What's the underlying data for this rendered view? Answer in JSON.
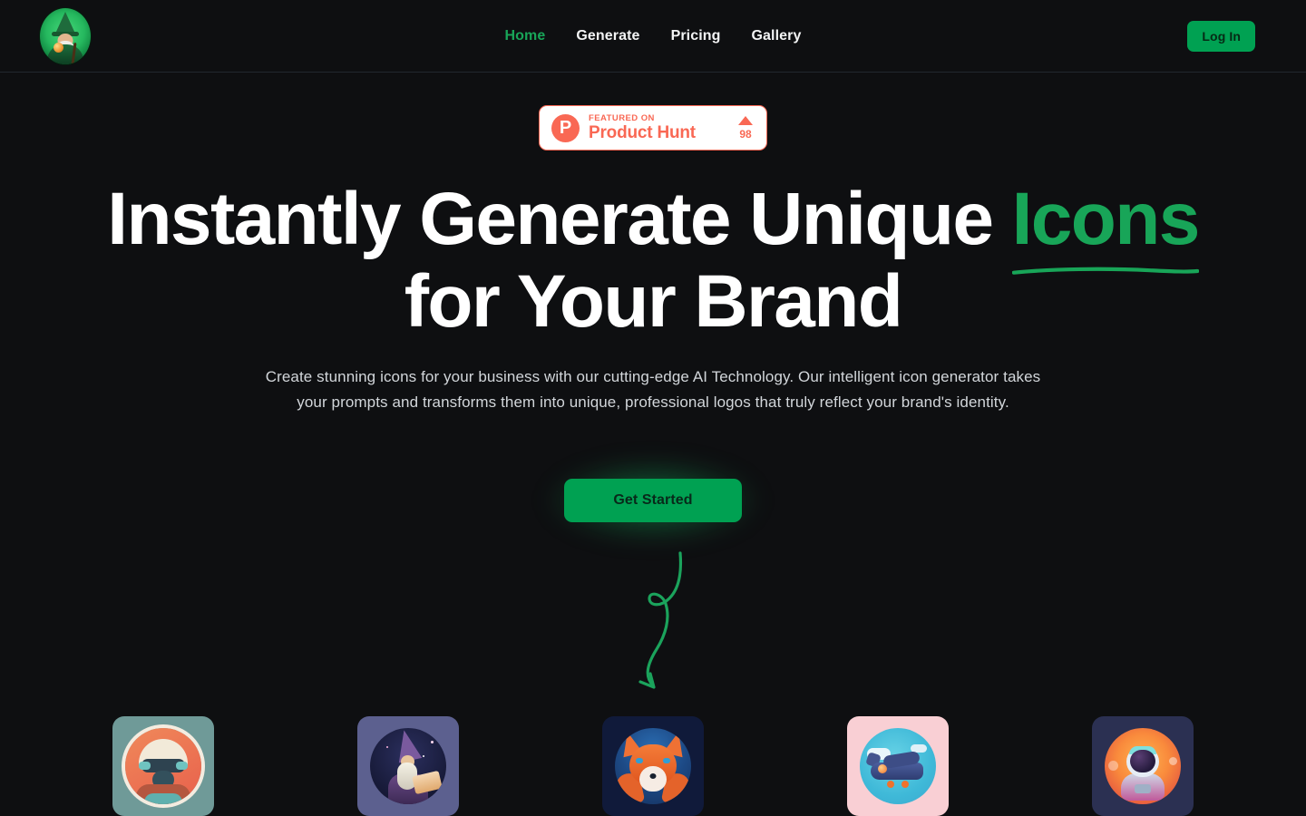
{
  "brand": {
    "logo_alt": "wizard-logo"
  },
  "nav": {
    "items": [
      {
        "label": "Home",
        "active": true
      },
      {
        "label": "Generate",
        "active": false
      },
      {
        "label": "Pricing",
        "active": false
      },
      {
        "label": "Gallery",
        "active": false
      }
    ],
    "login_label": "Log In"
  },
  "badge": {
    "logo_letter": "P",
    "featured_label": "FEATURED ON",
    "product_name": "Product Hunt",
    "upvote_count": "98"
  },
  "hero": {
    "title_part1": "Instantly Generate Unique ",
    "title_accent": "Icons",
    "title_part2": " for Your Brand",
    "subtitle": "Create stunning icons for your business with our cutting-edge AI Technology. Our intelligent icon generator takes your prompts and transforms them into unique, professional logos that truly reflect your brand's identity.",
    "cta_label": "Get Started"
  },
  "showcase": {
    "cards": [
      {
        "name": "pilot-icon"
      },
      {
        "name": "wizard-icon"
      },
      {
        "name": "fox-icon"
      },
      {
        "name": "airplane-icon"
      },
      {
        "name": "astronaut-icon"
      }
    ]
  },
  "colors": {
    "background": "#0e0f11",
    "accent_green": "#18a558",
    "button_green": "#00a152",
    "product_hunt_coral": "#f96854",
    "text_primary": "#ffffff",
    "text_secondary": "#d2d6da",
    "border": "#22272e"
  }
}
